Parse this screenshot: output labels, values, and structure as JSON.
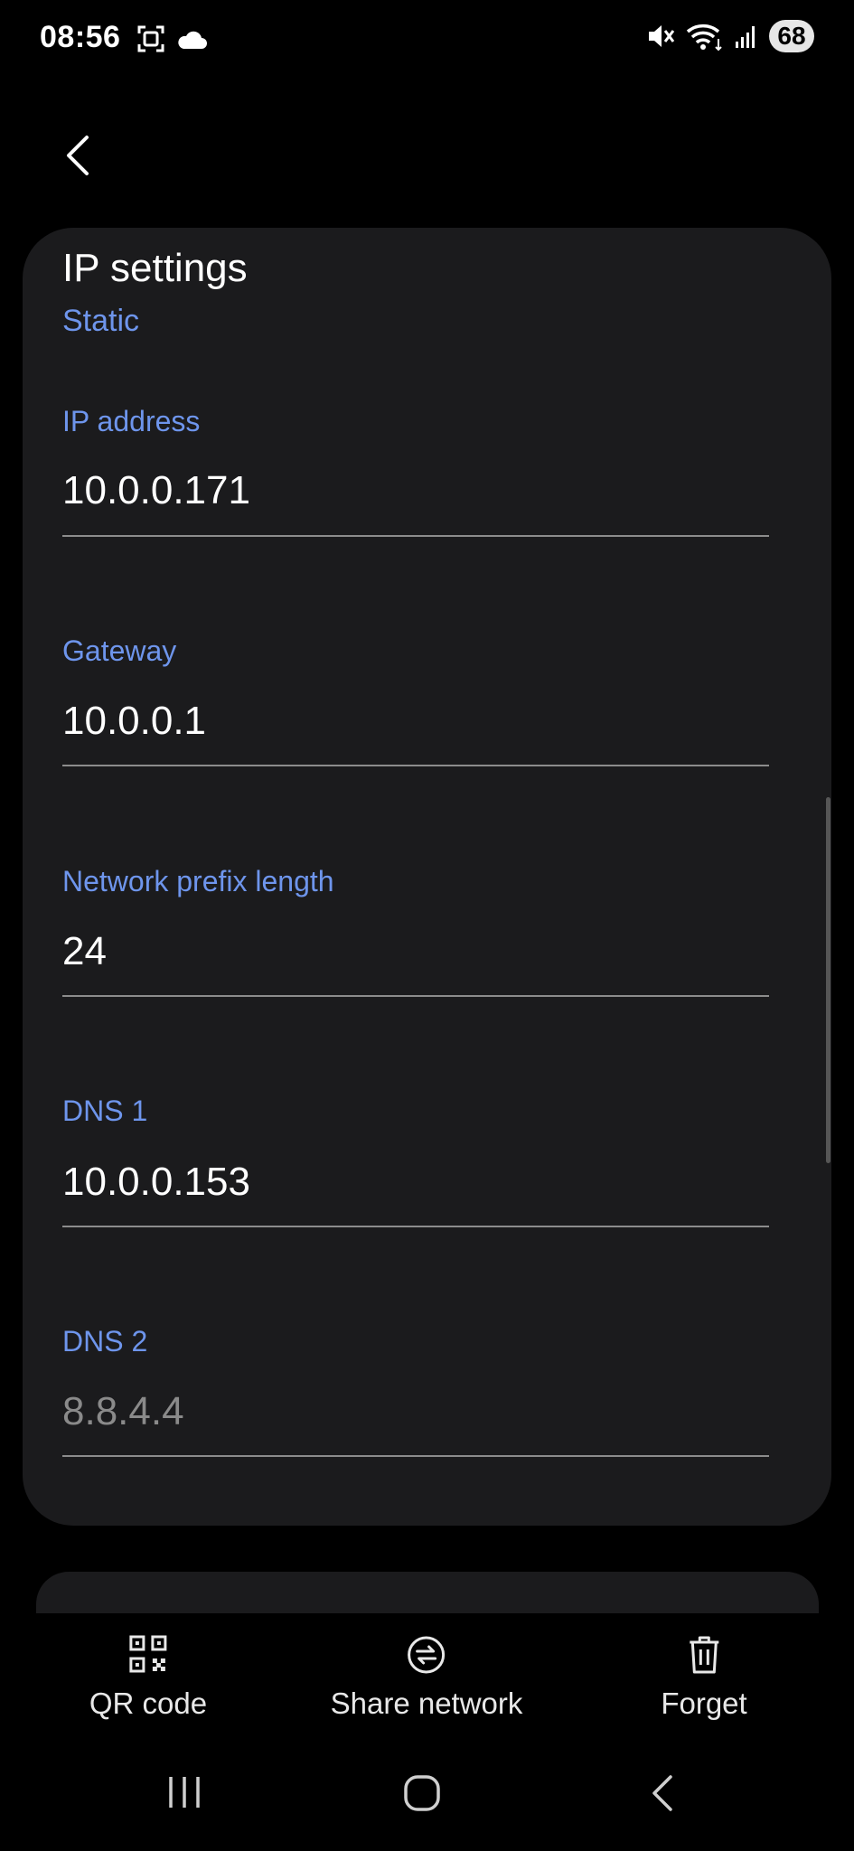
{
  "status_bar": {
    "time": "08:56",
    "battery": "68",
    "left_icons": [
      "screenshot-icon",
      "cloud-icon"
    ],
    "right_icons": [
      "mute-icon",
      "wifi-icon",
      "signal-icon"
    ]
  },
  "header": {
    "back_icon": "back-arrow-icon"
  },
  "ip_settings": {
    "title": "IP settings",
    "mode": "Static",
    "fields": [
      {
        "label": "IP address",
        "value": "10.0.0.171",
        "is_hint": false
      },
      {
        "label": "Gateway",
        "value": "10.0.0.1",
        "is_hint": false
      },
      {
        "label": "Network prefix length",
        "value": "24",
        "is_hint": false
      },
      {
        "label": "DNS 1",
        "value": "10.0.0.153",
        "is_hint": false
      },
      {
        "label": "DNS 2",
        "value": "8.8.4.4",
        "is_hint": true
      }
    ]
  },
  "bottom_actions": [
    {
      "label": "QR code",
      "icon": "qr-code-icon"
    },
    {
      "label": "Share network",
      "icon": "share-network-icon"
    },
    {
      "label": "Forget",
      "icon": "trash-icon"
    }
  ],
  "nav_bar": {
    "icons": [
      "recent-apps-icon",
      "home-icon",
      "back-icon"
    ]
  },
  "colors": {
    "background": "#000000",
    "card": "#1b1b1d",
    "accent_label": "#6e95ec",
    "text": "#ffffff",
    "hint": "#8a8a8a"
  }
}
